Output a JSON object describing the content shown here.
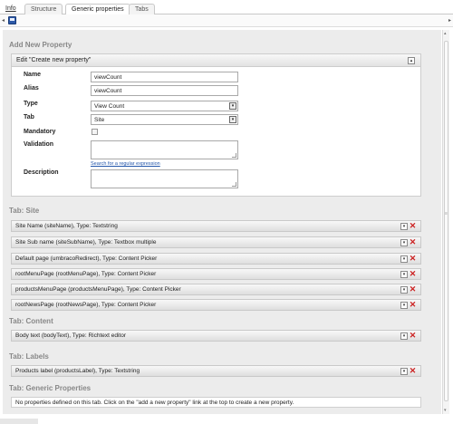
{
  "tabs": {
    "info": "Info",
    "structure": "Structure",
    "generic": "Generic properties",
    "tabs": "Tabs"
  },
  "toolbar": {
    "save_icon": "save-icon"
  },
  "add_property": {
    "section_title": "Add New Property",
    "box_title": "Edit \"Create new property\"",
    "name_label": "Name",
    "name_value": "viewCount",
    "alias_label": "Alias",
    "alias_value": "viewCount",
    "type_label": "Type",
    "type_value": "View Count",
    "tab_label": "Tab",
    "tab_value": "Site",
    "mandatory_label": "Mandatory",
    "mandatory_checked": false,
    "validation_label": "Validation",
    "regex_link": "Search for a regular expression",
    "description_label": "Description"
  },
  "groups": {
    "site": {
      "title": "Tab: Site",
      "items": [
        "Site Name (siteName), Type: Textstring",
        "Site Sub name (siteSubName), Type: Textbox multiple",
        "Default page (umbracoRedirect), Type: Content Picker",
        "rootMenuPage (rootMenuPage), Type: Content Picker",
        "productsMenuPage (productsMenuPage), Type: Content Picker",
        "rootNewsPage (rootNewsPage), Type: Content Picker"
      ]
    },
    "content": {
      "title": "Tab: Content",
      "items": [
        "Body text (bodyText), Type: Richtext editor"
      ]
    },
    "labels": {
      "title": "Tab: Labels",
      "items": [
        "Products label (productsLabel), Type: Textstring"
      ]
    },
    "generic": {
      "title": "Tab: Generic Properties",
      "notice": "No properties defined on this tab. Click on the \"add a new property\" link at the top to create a new property."
    }
  }
}
